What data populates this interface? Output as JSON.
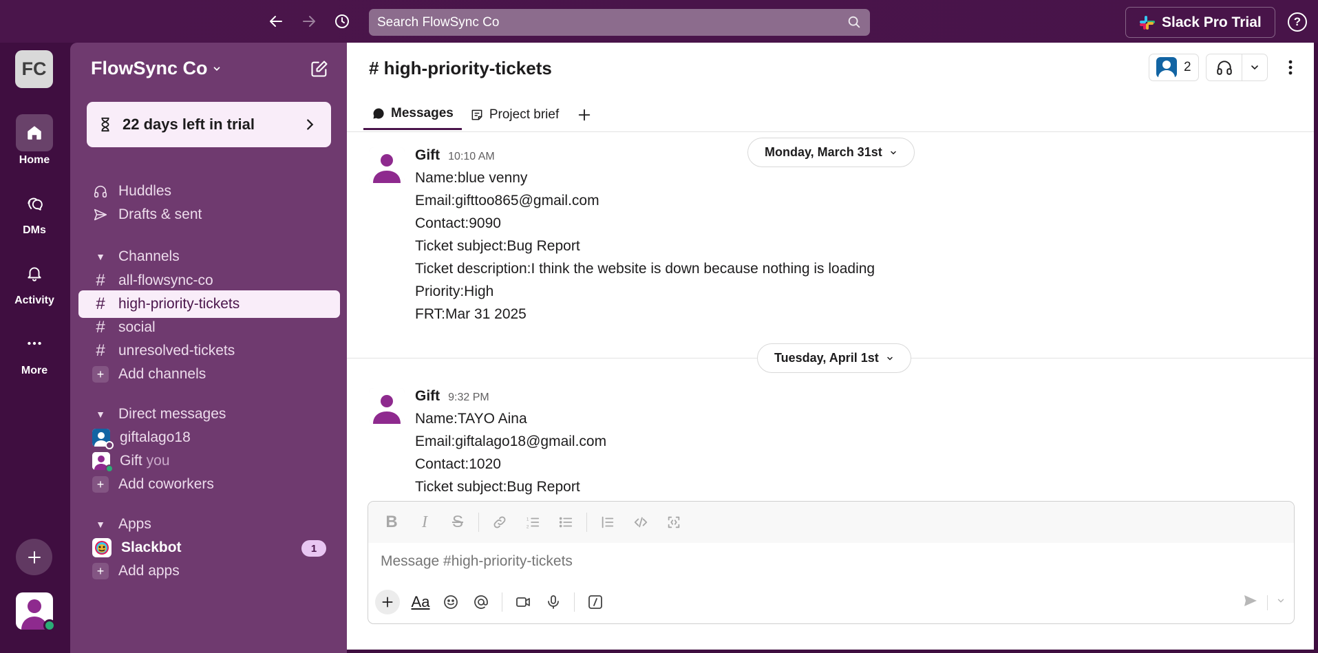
{
  "topbar": {
    "search_placeholder": "Search FlowSync Co",
    "trial_label": "Slack Pro Trial",
    "help_label": "?"
  },
  "rail": {
    "workspace_initials": "FC",
    "items": [
      {
        "label": "Home",
        "icon": "home-icon"
      },
      {
        "label": "DMs",
        "icon": "dms-icon"
      },
      {
        "label": "Activity",
        "icon": "bell-icon"
      },
      {
        "label": "More",
        "icon": "ellipsis-icon"
      }
    ]
  },
  "sidebar": {
    "workspace_name": "FlowSync Co",
    "trial_banner": "22 days left in trial",
    "nav": [
      {
        "label": "Huddles",
        "icon": "headphones-icon"
      },
      {
        "label": "Drafts & sent",
        "icon": "send-icon"
      }
    ],
    "channels_header": "Channels",
    "channels": [
      {
        "label": "all-flowsync-co"
      },
      {
        "label": "high-priority-tickets",
        "active": true
      },
      {
        "label": "social"
      },
      {
        "label": "unresolved-tickets"
      }
    ],
    "add_channels": "Add channels",
    "dm_header": "Direct messages",
    "dms": [
      {
        "label": "giftalago18",
        "suffix": ""
      },
      {
        "label": "Gift",
        "suffix": "you"
      }
    ],
    "add_coworkers": "Add coworkers",
    "apps_header": "Apps",
    "apps": [
      {
        "label": "Slackbot",
        "badge": "1"
      }
    ],
    "add_apps": "Add apps"
  },
  "channel": {
    "title": "# high-priority-tickets",
    "member_count": "2",
    "tabs": [
      {
        "label": "Messages",
        "active": true
      },
      {
        "label": "Project brief"
      }
    ]
  },
  "messages": {
    "dates": [
      "Monday, March 31st",
      "Tuesday, April 1st"
    ],
    "items": [
      {
        "author": "Gift",
        "time": "10:10 AM",
        "lines": [
          "Name:blue venny",
          "Email:gifttoo865@gmail.com",
          "Contact:9090",
          "Ticket subject:Bug Report",
          "Ticket description:I think the website is down because nothing is loading",
          "Priority:High",
          "FRT:Mar 31 2025"
        ]
      },
      {
        "author": "Gift",
        "time": "9:32 PM",
        "lines": [
          "Name:TAYO Aina",
          "Email:giftalago18@gmail.com",
          "Contact:1020",
          "Ticket subject:Bug Report"
        ]
      }
    ]
  },
  "composer": {
    "placeholder": "Message #high-priority-tickets",
    "format_buttons": [
      "bold-icon",
      "italic-icon",
      "strikethrough-icon",
      "link-icon",
      "ordered-list-icon",
      "bulleted-list-icon",
      "blockquote-icon",
      "code-icon",
      "code-block-icon"
    ],
    "action_buttons": [
      "plus-icon",
      "text-format-icon",
      "emoji-icon",
      "mention-icon",
      "video-icon",
      "microphone-icon",
      "slash-command-icon"
    ],
    "text_format_label": "Aa"
  },
  "colors": {
    "aubergine": "#4a154b",
    "sidebar": "#6f3a6f",
    "active_row": "#f9edf9",
    "online": "#2bac76"
  }
}
